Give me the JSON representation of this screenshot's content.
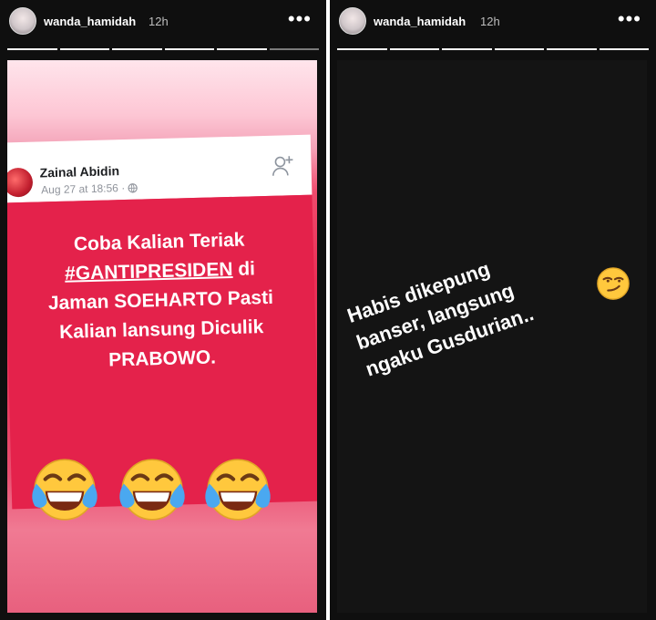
{
  "stories": [
    {
      "username": "wanda_hamidah",
      "time": "12h",
      "progress_filled": 5,
      "progress_total": 6,
      "post": {
        "author": "Zainal Abidin",
        "date": "Aug 27 at 18:56 ·",
        "text_lines": [
          "Coba Kalian Teriak",
          "#GANTIPRESIDEN",
          "di",
          "Jaman SOEHARTO Pasti",
          "Kalian lansung Diculik",
          "PRABOWO."
        ]
      },
      "emojis": [
        "face-with-tears-of-joy",
        "face-with-tears-of-joy",
        "face-with-tears-of-joy"
      ]
    },
    {
      "username": "wanda_hamidah",
      "time": "12h",
      "progress_filled": 6,
      "progress_total": 6,
      "text_lines": [
        "Habis dikepung",
        "banser, langsung",
        "ngaku Gusdurian.."
      ],
      "sticker": "smirking-face"
    }
  ],
  "colors": {
    "post_red": "#e4224b",
    "story_dark": "#141414",
    "emoji_yellow": "#ffc83d"
  }
}
